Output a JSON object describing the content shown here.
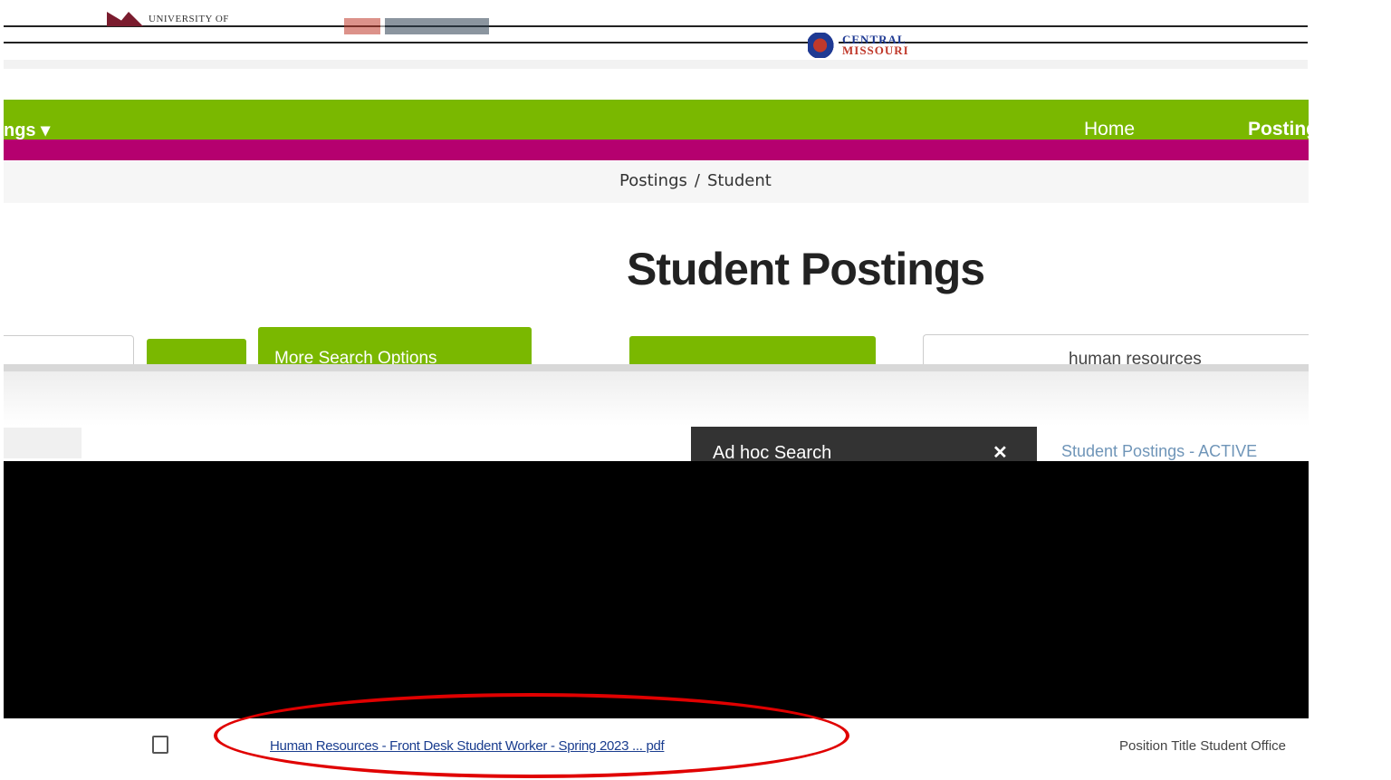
{
  "header": {
    "university_logo_text": "UNIVERSITY OF",
    "cmu_logo_line1": "CENTRAL",
    "cmu_logo_line2": "MISSOURI"
  },
  "nav": {
    "postings_menu_label": "ngs ▾",
    "home_label": "Home",
    "postings_label": "Postings",
    "green": "#7ab800",
    "magenta": "#b5006f"
  },
  "breadcrumb": {
    "first": "Postings",
    "separator": "/",
    "second": "Student"
  },
  "page": {
    "title": "Student Postings"
  },
  "toolbar": {
    "more_search_label": "More Search Options",
    "search_value": "human resources"
  },
  "results": {
    "adhoc_label": "Ad hoc Search",
    "close_glyph": "✕",
    "list_label": "Student Postings - ACTIVE"
  },
  "download_bar": {
    "file_name": "Human Resources - Front Desk Student Worker - Spring 2023 ... pdf",
    "right_file_name": "Position Title Student Office"
  },
  "annotation": {
    "circle_color": "#e00000"
  }
}
